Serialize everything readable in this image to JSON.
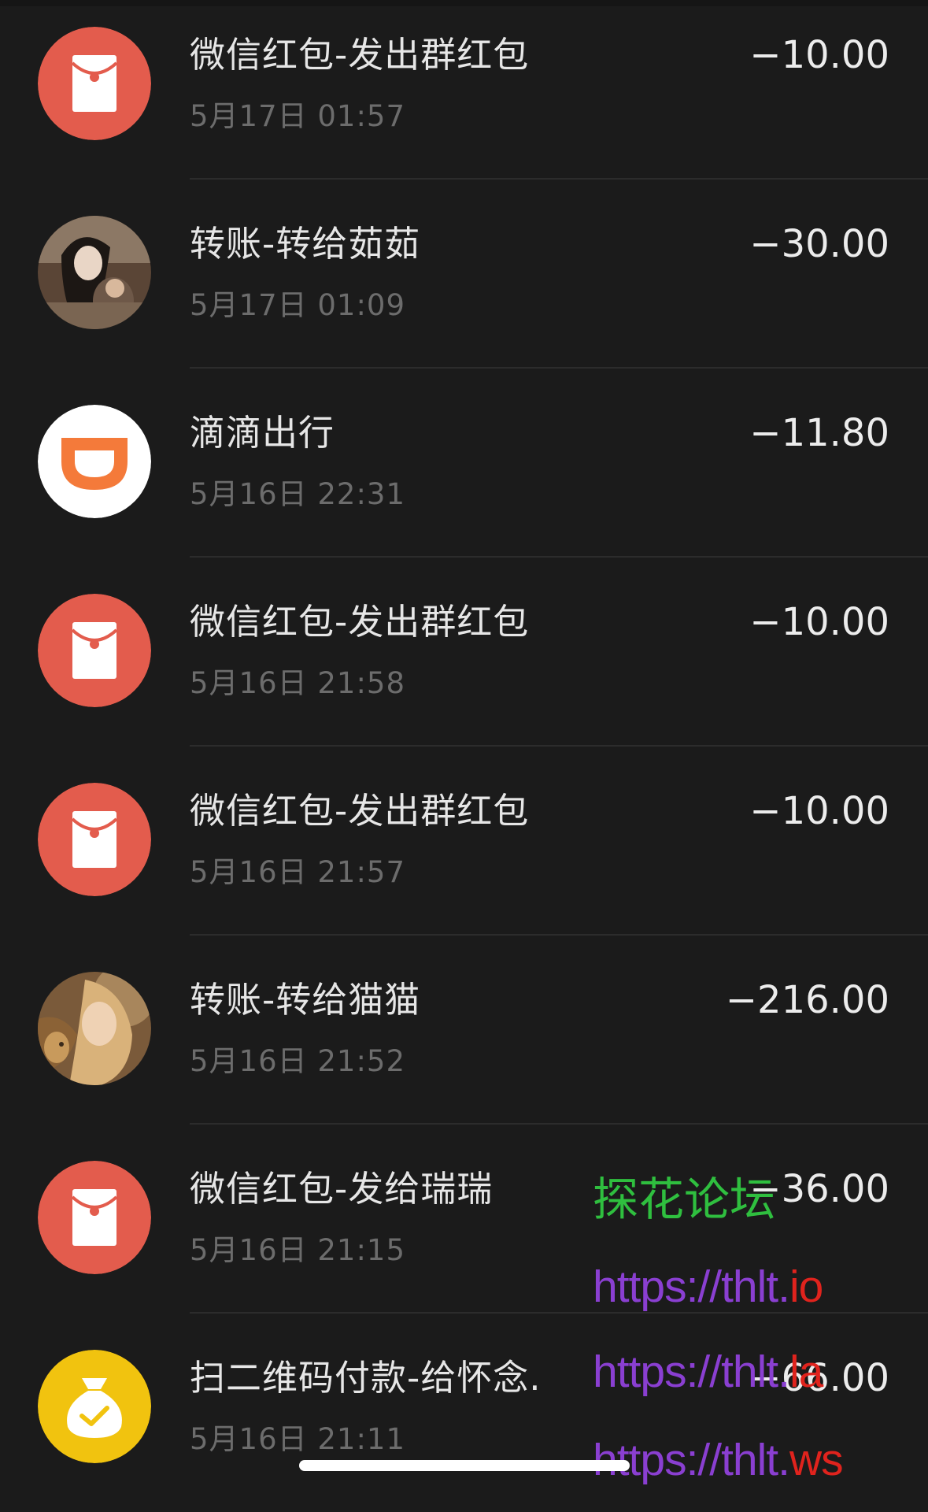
{
  "colors": {
    "background": "#1b1b1b",
    "red_packet": "#e35c4d",
    "didi_orange": "#f47a3a",
    "qr_yellow": "#f1c30f",
    "watermark_green": "#2fbf3f",
    "watermark_purple": "#8a3fd1",
    "watermark_red": "#e0231d"
  },
  "transactions": [
    {
      "title": "微信红包-发出群红包",
      "time": "5月17日 01:57",
      "amount": "−10.00",
      "icon": "red-packet-icon"
    },
    {
      "title": "转账-转给茹茹",
      "time": "5月17日 01:09",
      "amount": "−30.00",
      "icon": "contact-avatar"
    },
    {
      "title": "滴滴出行",
      "time": "5月16日 22:31",
      "amount": "−11.80",
      "icon": "didi-icon"
    },
    {
      "title": "微信红包-发出群红包",
      "time": "5月16日 21:58",
      "amount": "−10.00",
      "icon": "red-packet-icon"
    },
    {
      "title": "微信红包-发出群红包",
      "time": "5月16日 21:57",
      "amount": "−10.00",
      "icon": "red-packet-icon"
    },
    {
      "title": "转账-转给猫猫",
      "time": "5月16日 21:52",
      "amount": "−216.00",
      "icon": "contact-avatar"
    },
    {
      "title": "微信红包-发给瑞瑞",
      "time": "5月16日 21:15",
      "amount": "−36.00",
      "icon": "red-packet-icon"
    },
    {
      "title": "扫二维码付款-给怀念.",
      "time": "5月16日 21:11",
      "amount": "−66.00",
      "icon": "money-bag-icon"
    }
  ],
  "watermark": {
    "forum": "探花论坛",
    "link1_prefix": "https://thlt.",
    "link1_suffix": "io",
    "link2_prefix": "https://thlt.",
    "link2_suffix": "la",
    "link3_prefix": "https://thlt.",
    "link3_suffix": "ws"
  }
}
